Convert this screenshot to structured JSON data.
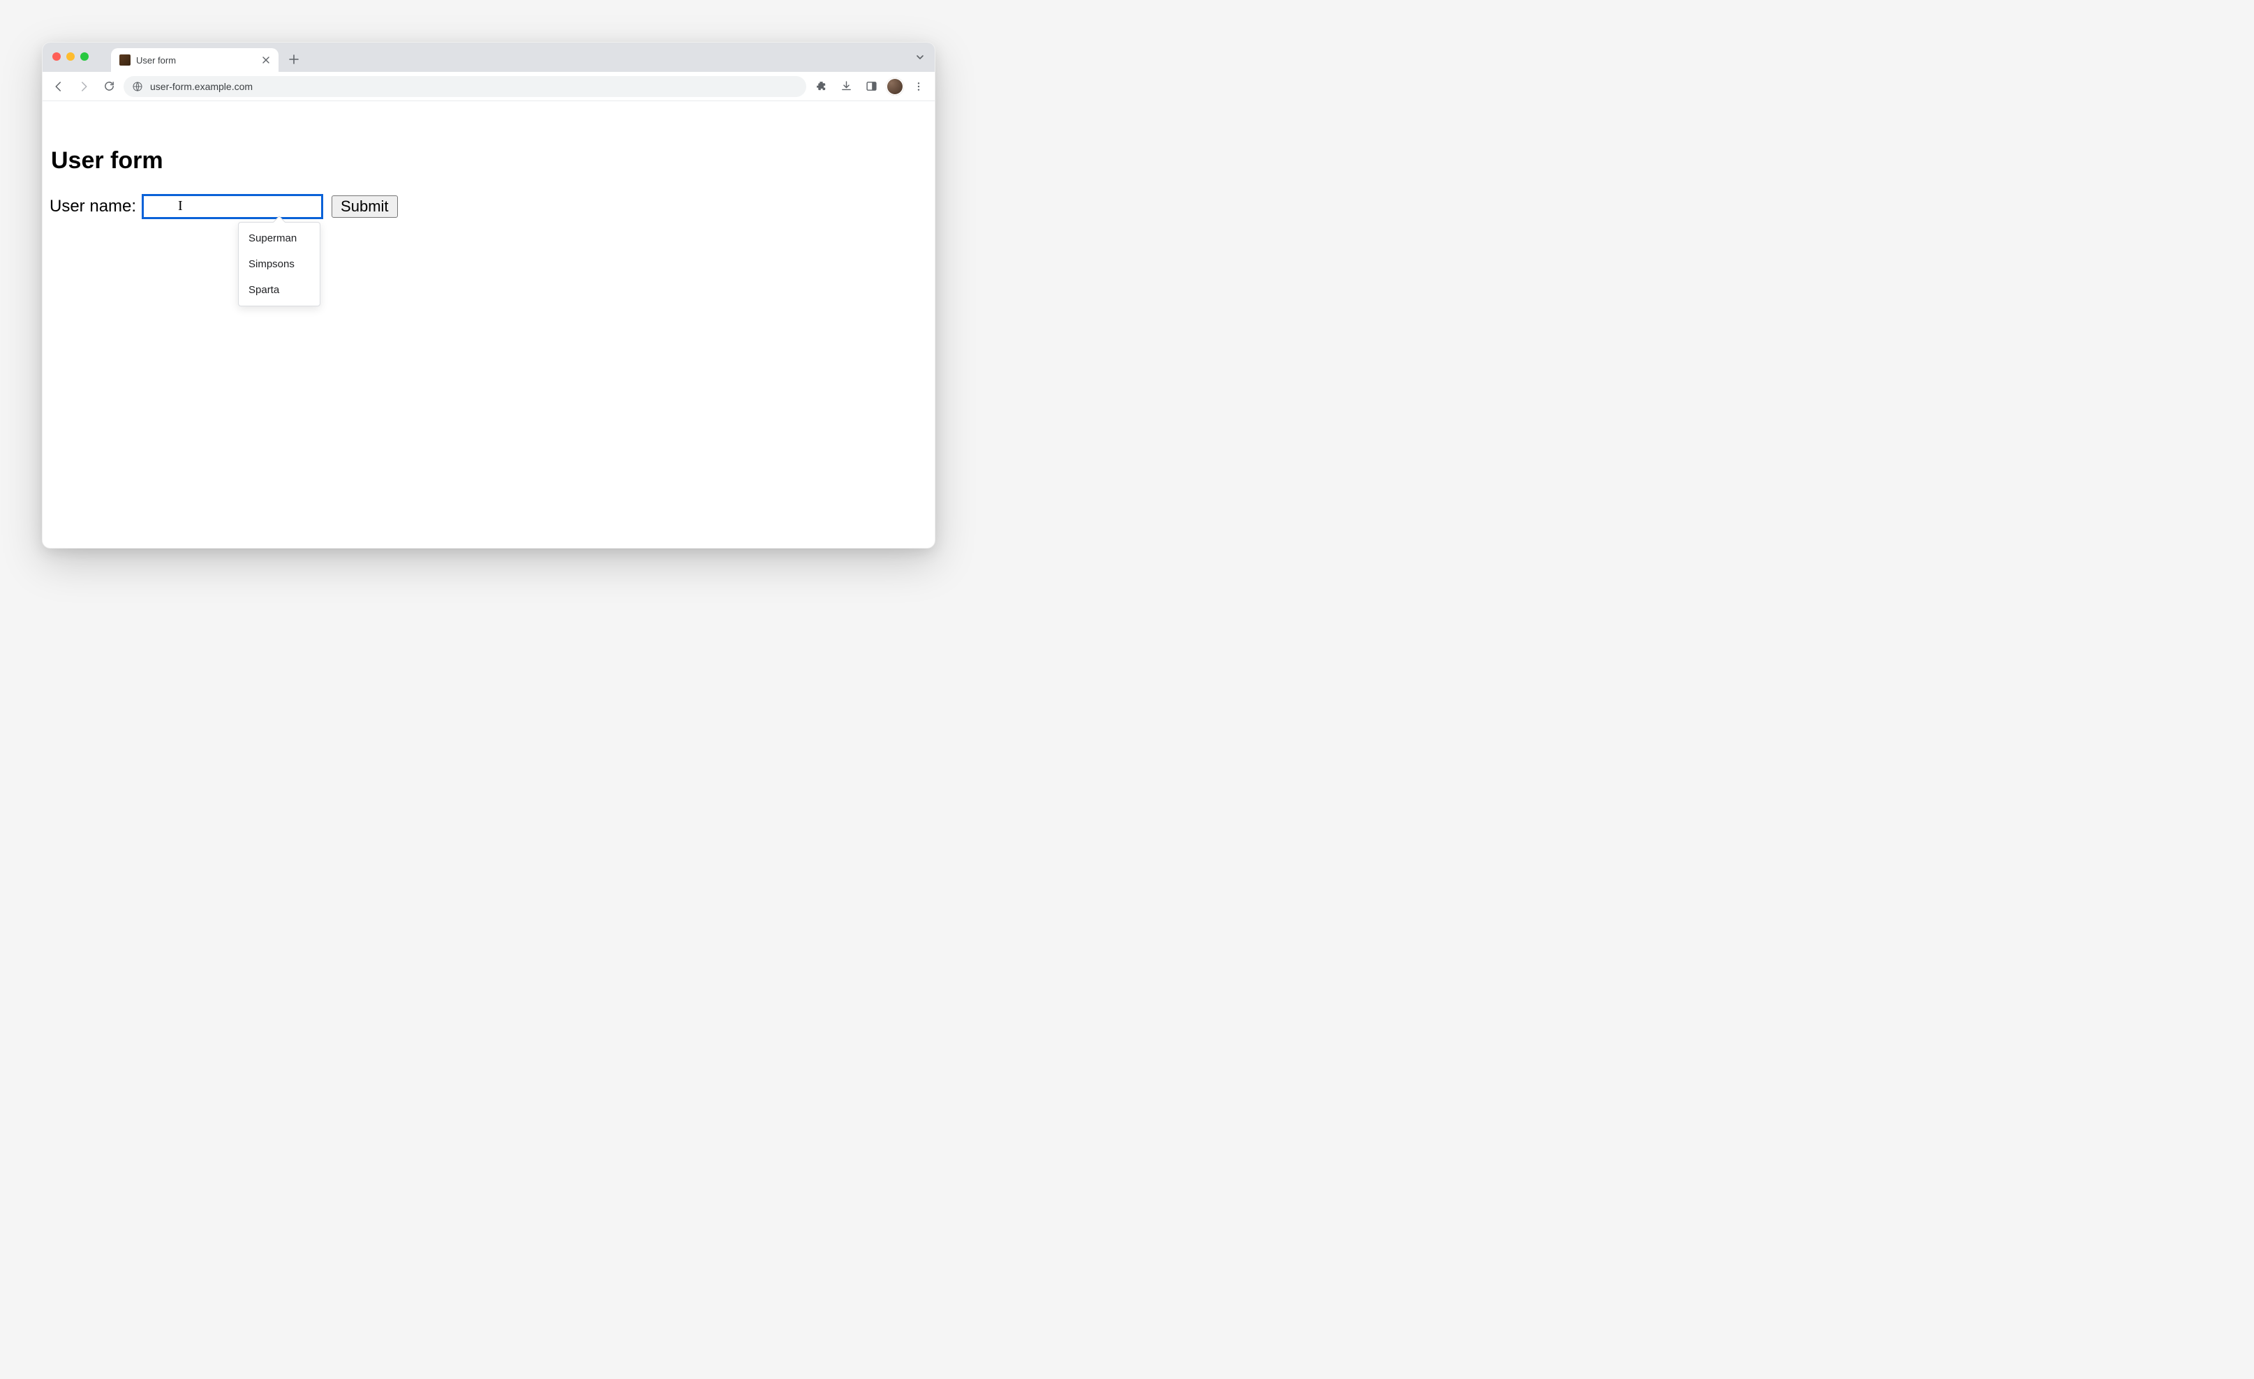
{
  "browser": {
    "tab_title": "User form",
    "url": "user-form.example.com"
  },
  "page": {
    "title": "User form"
  },
  "form": {
    "username_label": "User name:",
    "username_value": "",
    "submit_label": "Submit"
  },
  "autocomplete": {
    "items": [
      "Superman",
      "Simpsons",
      "Sparta"
    ]
  }
}
